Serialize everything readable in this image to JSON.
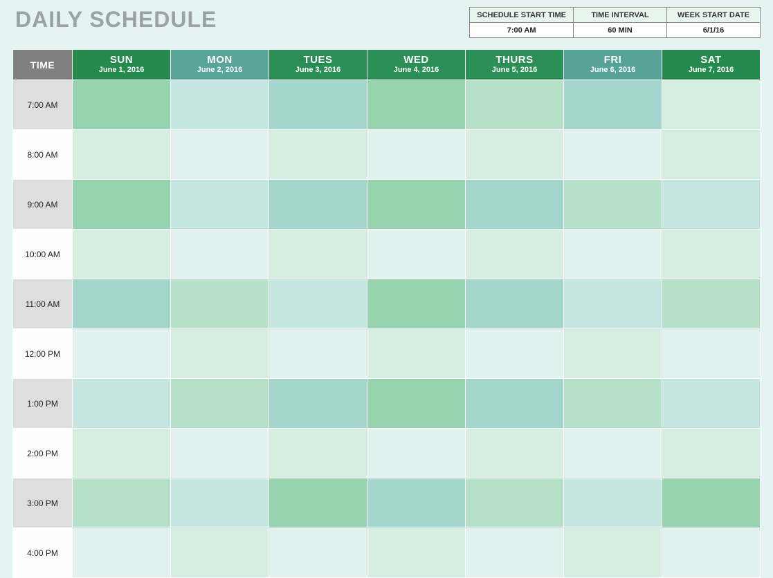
{
  "title": "DAILY SCHEDULE",
  "config": {
    "headers": [
      "SCHEDULE START TIME",
      "TIME INTERVAL",
      "WEEK START DATE"
    ],
    "values": [
      "7:00 AM",
      "60 MIN",
      "6/1/16"
    ]
  },
  "timeHeader": "TIME",
  "days": [
    {
      "key": "sun",
      "name": "SUN",
      "date": "June 1, 2016"
    },
    {
      "key": "mon",
      "name": "MON",
      "date": "June 2, 2016"
    },
    {
      "key": "tues",
      "name": "TUES",
      "date": "June 3, 2016"
    },
    {
      "key": "wed",
      "name": "WED",
      "date": "June 4, 2016"
    },
    {
      "key": "thurs",
      "name": "THURS",
      "date": "June 5, 2016"
    },
    {
      "key": "fri",
      "name": "FRI",
      "date": "June 6, 2016"
    },
    {
      "key": "sat",
      "name": "SAT",
      "date": "June 7, 2016"
    }
  ],
  "times": [
    "7:00 AM",
    "8:00 AM",
    "9:00 AM",
    "10:00 AM",
    "11:00 AM",
    "12:00 PM",
    "1:00 PM",
    "2:00 PM",
    "3:00 PM",
    "4:00 PM"
  ],
  "cellColors": [
    [
      "c-green-mid",
      "c-teal-light",
      "c-teal-mid",
      "c-green-mid",
      "c-green-light",
      "c-teal-mid",
      "c-green-pale"
    ],
    [
      "c-green-pale",
      "c-teal-pale",
      "c-green-pale",
      "c-teal-pale",
      "c-green-pale",
      "c-teal-pale",
      "c-green-pale"
    ],
    [
      "c-green-mid",
      "c-teal-light",
      "c-teal-mid",
      "c-green-mid",
      "c-teal-mid",
      "c-green-light",
      "c-teal-light"
    ],
    [
      "c-green-pale",
      "c-teal-pale",
      "c-green-pale",
      "c-teal-pale",
      "c-green-pale",
      "c-teal-pale",
      "c-green-pale"
    ],
    [
      "c-teal-mid",
      "c-green-light",
      "c-teal-light",
      "c-green-mid",
      "c-teal-mid",
      "c-teal-light",
      "c-green-light"
    ],
    [
      "c-teal-pale",
      "c-green-pale",
      "c-teal-pale",
      "c-green-pale",
      "c-teal-pale",
      "c-green-pale",
      "c-teal-pale"
    ],
    [
      "c-teal-light",
      "c-green-light",
      "c-teal-mid",
      "c-green-mid",
      "c-teal-mid",
      "c-green-light",
      "c-teal-light"
    ],
    [
      "c-green-pale",
      "c-teal-pale",
      "c-green-pale",
      "c-teal-pale",
      "c-green-pale",
      "c-teal-pale",
      "c-green-pale"
    ],
    [
      "c-green-light",
      "c-teal-light",
      "c-green-mid",
      "c-teal-mid",
      "c-green-light",
      "c-teal-light",
      "c-green-mid"
    ],
    [
      "c-teal-pale",
      "c-green-pale",
      "c-teal-pale",
      "c-green-pale",
      "c-teal-pale",
      "c-green-pale",
      "c-teal-pale"
    ]
  ]
}
